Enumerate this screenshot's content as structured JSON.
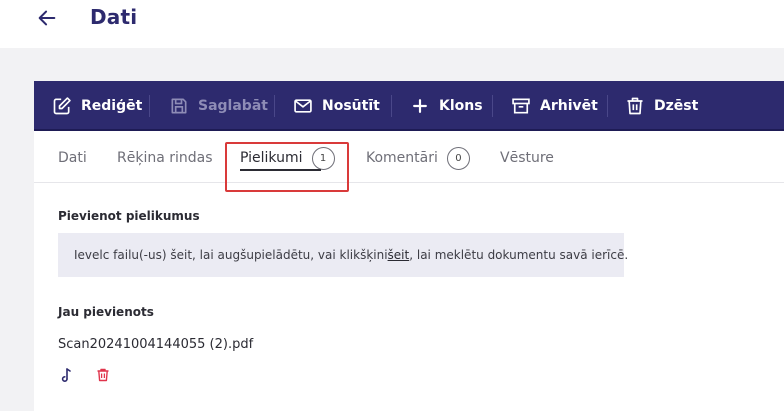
{
  "header": {
    "title": "Dati"
  },
  "toolbar": {
    "edit": "Rediģēt",
    "save": "Saglabāt",
    "send": "Nosūtīt",
    "clone": "Klons",
    "archive": "Arhivēt",
    "delete": "Dzēst"
  },
  "tabs": {
    "items": [
      {
        "label": "Dati"
      },
      {
        "label": "Rēķina rindas"
      },
      {
        "label": "Pielikumi",
        "count": "1"
      },
      {
        "label": "Komentāri",
        "count": "0"
      },
      {
        "label": "Vēsture"
      }
    ]
  },
  "attachments": {
    "add_title": "Pievienot pielikumus",
    "drop_text_before": "Ievelc failu(-us) šeit, lai augšupielādētu, vai klikšķini ",
    "drop_link": "šeit",
    "drop_text_after": ", lai meklētu dokumentu savā ierīcē.",
    "existing_title": "Jau pievienots",
    "files": [
      {
        "name": "Scan20241004144055 (2).pdf"
      }
    ]
  },
  "colors": {
    "brand": "#2d2a6e",
    "highlight": "#d93a3a",
    "danger": "#e0344c"
  }
}
